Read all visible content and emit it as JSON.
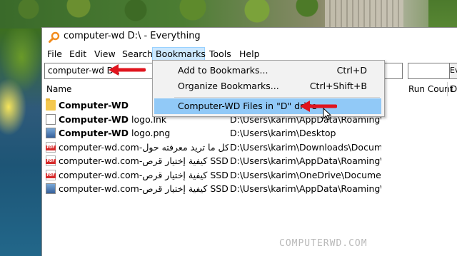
{
  "window": {
    "title": "computer-wd D:\\ - Everything"
  },
  "menubar": {
    "items": [
      "File",
      "Edit",
      "View",
      "Search",
      "Bookmarks",
      "Tools",
      "Help"
    ],
    "active": "Bookmarks"
  },
  "search": {
    "value": "computer-wd D:\\",
    "right_button": "Ev"
  },
  "columns": {
    "name": "Name",
    "run_count": "Run Count",
    "extra": "D"
  },
  "rows": [
    {
      "icon": "folder-icon",
      "name": "Computer-WD",
      "bold": true,
      "path": ""
    },
    {
      "icon": "file-icon",
      "name_bold": "Computer-WD",
      "name_rest": " logo.lnk",
      "path": "D:\\Users\\karim\\AppData\\Roaming\\M..."
    },
    {
      "icon": "image-icon",
      "name_bold": "Computer-WD",
      "name_rest": " logo.png",
      "path": "D:\\Users\\karim\\Desktop"
    },
    {
      "icon": "pdf-icon",
      "name": "computer-wd.com-كل ما تريد معرفته حول",
      "path": "D:\\Users\\karim\\Downloads\\Documents"
    },
    {
      "icon": "pdf-icon",
      "name": "computer-wd.com-كيفية إختيار قرص SSD ل",
      "path": "D:\\Users\\karim\\AppData\\Roaming\\M..."
    },
    {
      "icon": "pdf-icon",
      "name": "computer-wd.com-كيفية إختيار قرص SSD ل",
      "path": "D:\\Users\\karim\\OneDrive\\Documents"
    },
    {
      "icon": "image-icon",
      "name": "computer-wd.com-كيفية إختيار قرص SSD ل",
      "path": "D:\\Users\\karim\\AppData\\Roaming\\M..."
    }
  ],
  "dropdown": {
    "items": [
      {
        "label": "Add to Bookmarks...",
        "shortcut": "Ctrl+D"
      },
      {
        "label": "Organize Bookmarks...",
        "shortcut": "Ctrl+Shift+B"
      },
      {
        "label": "Computer-WD Files in \"D\" drive",
        "shortcut": ""
      }
    ],
    "highlighted_index": 2
  },
  "watermark": "COMPUTERWD.COM",
  "colors": {
    "menu_active_bg": "#cce8ff",
    "dropdown_highlight": "#91c9f7",
    "arrow": "#e0141e"
  }
}
